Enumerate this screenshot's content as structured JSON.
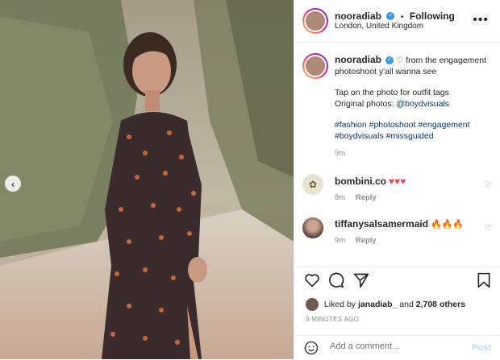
{
  "header": {
    "username": "nooradiab",
    "separator": "•",
    "follow_label": "Following",
    "location": "London, United Kingdom",
    "more_icon": "more-dots-icon"
  },
  "caption": {
    "username": "nooradiab",
    "line1": "♡ from the engagement photoshoot y'all wanna see",
    "line2": "Tap on the photo for outfit tags",
    "line3_prefix": "Original photos: ",
    "line3_link": "@boydvisuals",
    "hashtags_line1": "#fashion #photoshoot #engagement",
    "hashtags_line2": "#boydvisuals #missguided",
    "time": "9m"
  },
  "comments": [
    {
      "username": "bombini.co",
      "text": "♥♥♥",
      "time": "8m",
      "reply": "Reply"
    },
    {
      "username": "tiffanysalsamermaid",
      "text": "🔥🔥🔥",
      "time": "9m",
      "reply": "Reply"
    }
  ],
  "actions": {
    "icons": [
      "heart-icon",
      "comment-icon",
      "share-icon",
      "bookmark-icon"
    ]
  },
  "likes": {
    "text_prefix": "Liked by ",
    "user": "janadiab_",
    "text_mid": " and ",
    "count": "2,708 others"
  },
  "timestamp": "9 MINUTES AGO",
  "add_comment": {
    "placeholder": "Add a comment…",
    "post_label": "Post"
  },
  "colors": {
    "link": "#00376b",
    "meta": "#8e8e8e",
    "verified": "#3897f0",
    "post_disabled": "#b3dbff",
    "heart_red": "#ed4956"
  }
}
